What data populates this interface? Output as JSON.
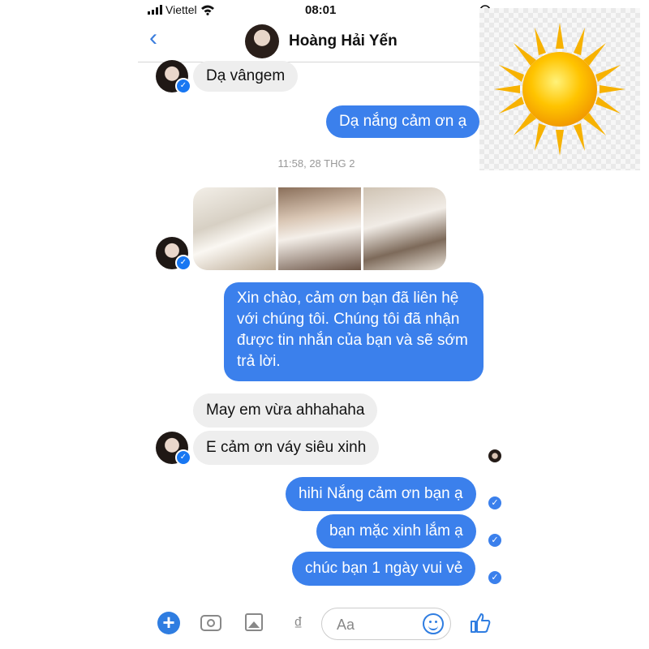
{
  "status_bar": {
    "carrier": "Viettel",
    "time": "08:01"
  },
  "header": {
    "contact_name": "Hoàng Hải Yến"
  },
  "messages": [
    {
      "from": "them",
      "text": "Dạ vângem"
    },
    {
      "from": "me",
      "text": "Dạ nắng cảm ơn ạ"
    },
    {
      "timestamp": "11:58, 28 THG 2"
    },
    {
      "from": "them",
      "type": "photos",
      "count": 3
    },
    {
      "from": "me",
      "text": "Xin chào, cảm ơn bạn đã liên hệ với chúng tôi. Chúng tôi đã nhận được tin nhắn của bạn và sẽ sớm trả lời."
    },
    {
      "from": "them",
      "text": "May em vừa ahhahaha"
    },
    {
      "from": "them",
      "text": "E cảm ơn váy siêu xinh"
    },
    {
      "from": "me",
      "text": "hihi Nắng cảm ơn bạn ạ"
    },
    {
      "from": "me",
      "text": "bạn mặc xinh lắm ạ"
    },
    {
      "from": "me",
      "text": "chúc bạn 1 ngày vui vẻ"
    }
  ],
  "composer": {
    "placeholder": "Aa",
    "currency_symbol": "₫"
  },
  "colors": {
    "accent": "#3b80ec",
    "incoming_bubble": "#eeeeee",
    "sun": "#f5b400"
  }
}
